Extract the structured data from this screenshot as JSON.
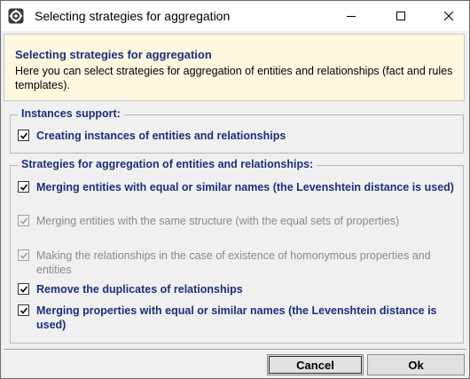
{
  "window": {
    "title": "Selecting strategies for aggregation"
  },
  "header": {
    "title": "Selecting strategies for aggregation",
    "description": "Here you can select strategies for aggregation of entities and relationships (fact and rules templates)."
  },
  "instances_group": {
    "label": "Instances support:",
    "items": [
      {
        "label": "Creating instances of entities and relationships",
        "checked": true,
        "enabled": true
      }
    ]
  },
  "strategies_group": {
    "label": "Strategies for aggregation of entities and relationships:",
    "items": [
      {
        "label": "Merging entities with equal or similar names (the Levenshtein distance is used)",
        "checked": true,
        "enabled": true
      },
      {
        "label": "Merging entities with the same structure (with the equal sets of properties)",
        "checked": true,
        "enabled": false
      },
      {
        "label": "Making the relationships in the case of existence of homonymous properties and entities",
        "checked": true,
        "enabled": false
      },
      {
        "label": "Remove the duplicates of relationships",
        "checked": true,
        "enabled": true
      },
      {
        "label": "Merging properties with equal or similar names (the Levenshtein distance is used)",
        "checked": true,
        "enabled": true
      }
    ]
  },
  "buttons": {
    "cancel": "Cancel",
    "ok": "Ok"
  },
  "colors": {
    "label_blue": "#1c2f7a",
    "header_bg": "#fff8e1",
    "dialog_bg": "#f0f0f0",
    "disabled_text": "#8a8a8a"
  },
  "icons": {
    "app": "gear-icon",
    "minimize": "minimize-icon",
    "maximize": "maximize-icon",
    "close": "close-icon",
    "check": "checkmark-icon"
  }
}
